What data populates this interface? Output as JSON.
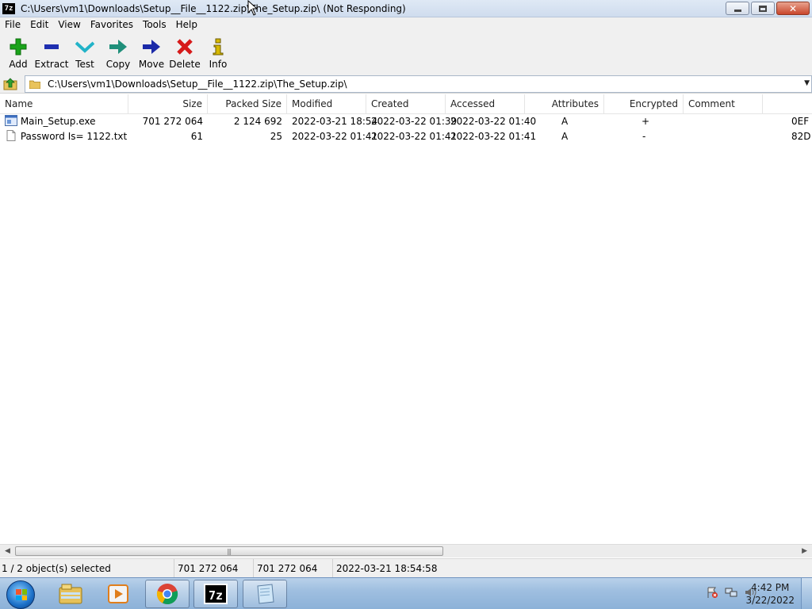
{
  "window": {
    "app_icon_text": "7z",
    "title": "C:\\Users\\vm1\\Downloads\\Setup__File__1122.zip\\The_Setup.zip\\ (Not Responding)"
  },
  "menu": [
    "File",
    "Edit",
    "View",
    "Favorites",
    "Tools",
    "Help"
  ],
  "toolbar": [
    {
      "label": "Add",
      "icon": "plus-icon",
      "color": "#1aa31a"
    },
    {
      "label": "Extract",
      "icon": "minus-icon",
      "color": "#1f2fb0"
    },
    {
      "label": "Test",
      "icon": "checkmark-icon",
      "color": "#22b3c8"
    },
    {
      "label": "Copy",
      "icon": "copy-arrow-icon",
      "color": "#1f8f7a"
    },
    {
      "label": "Move",
      "icon": "move-arrow-icon",
      "color": "#1b2aa8"
    },
    {
      "label": "Delete",
      "icon": "delete-x-icon",
      "color": "#d61a1a"
    },
    {
      "label": "Info",
      "icon": "info-icon",
      "color": "#d6b800"
    }
  ],
  "address": {
    "path": "C:\\Users\\vm1\\Downloads\\Setup__File__1122.zip\\The_Setup.zip\\"
  },
  "columns": [
    "Name",
    "Size",
    "Packed Size",
    "Modified",
    "Created",
    "Accessed",
    "Attributes",
    "Encrypted",
    "Comment"
  ],
  "files": [
    {
      "name": "Main_Setup.exe",
      "icon": "exe-file-icon",
      "size": "701 272 064",
      "packed": "2 124 692",
      "modified": "2022-03-21 18:54",
      "created": "2022-03-22 01:39",
      "accessed": "2022-03-22 01:40",
      "attributes": "A",
      "encrypted": "+",
      "comment": "",
      "trailing": "0EF"
    },
    {
      "name": "Password Is=   1122.txt",
      "icon": "text-file-icon",
      "size": "61",
      "packed": "25",
      "modified": "2022-03-22 01:41",
      "created": "2022-03-22 01:41",
      "accessed": "2022-03-22 01:41",
      "attributes": "A",
      "encrypted": "-",
      "comment": "",
      "trailing": "82D"
    }
  ],
  "status": {
    "selection": "1 / 2 object(s) selected",
    "size": "701 272 064",
    "packed": "701 272 064",
    "modified": "2022-03-21 18:54:58"
  },
  "taskbar": {
    "apps": [
      {
        "name": "file-explorer-icon",
        "active": false
      },
      {
        "name": "media-player-icon",
        "active": false
      },
      {
        "name": "chrome-icon",
        "active": true
      },
      {
        "name": "7zip-icon",
        "active": true,
        "label": "7z"
      },
      {
        "name": "notepad-icon",
        "active": true
      }
    ],
    "time": "4:42 PM",
    "date": "3/22/2022"
  }
}
